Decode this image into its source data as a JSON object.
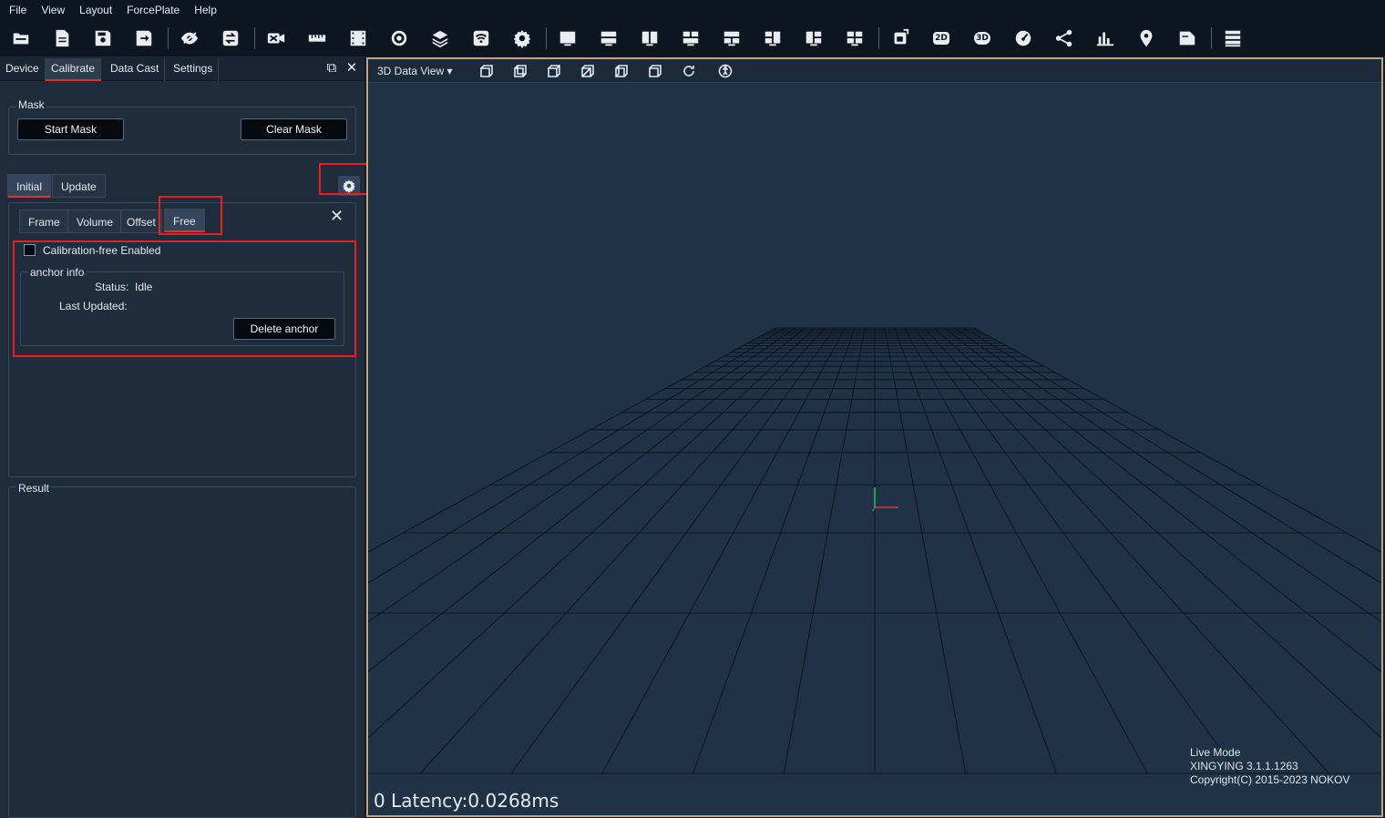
{
  "menu": [
    "File",
    "View",
    "Layout",
    "ForcePlate",
    "Help"
  ],
  "toolbar": {
    "icons": [
      "open-folder-icon",
      "new-file-icon",
      "save-icon",
      "export-icon",
      "hide-icon",
      "sync-icon",
      "camera-off-icon",
      "ruler-icon",
      "film-icon",
      "record-icon",
      "layers-icon",
      "wifi-icon",
      "settings-icon",
      "layout-single-icon",
      "layout-two-row-icon",
      "layout-two-col-icon",
      "layout-grid-icon",
      "layout-top-two-icon",
      "layout-left-two-icon",
      "layout-right-two-icon",
      "layout-four-icon",
      "rotate-view-icon",
      "view-2d-icon",
      "view-3d-icon",
      "speedometer-icon",
      "skeleton-icon",
      "bar-chart-icon",
      "location-pin-icon",
      "document-icon",
      "list-icon"
    ],
    "label_2d": "2D",
    "label_3d": "3D"
  },
  "panel": {
    "tabs": [
      "Device",
      "Calibrate",
      "Data Cast",
      "Settings"
    ],
    "active_tab": "Calibrate"
  },
  "mask": {
    "title": "Mask",
    "start_label": "Start Mask",
    "clear_label": "Clear Mask"
  },
  "calib_tabs": [
    "Initial",
    "Update"
  ],
  "sub_tabs": [
    "Frame",
    "Volume",
    "Offset",
    "Free"
  ],
  "free": {
    "checkbox_label": "Calibration-free Enabled",
    "checked": false,
    "anchor_title": "anchor info",
    "status_label": "Status:",
    "status_value": "Idle",
    "last_updated_label": "Last Updated:",
    "last_updated_value": "",
    "delete_label": "Delete anchor"
  },
  "result": {
    "title": "Result"
  },
  "view": {
    "title": "3D Data View",
    "latency": "0 Latency:0.0268ms",
    "mode": "Live Mode",
    "version": "XINGYING 3.1.1.1263",
    "copyright": "Copyright(C) 2015-2023 NOKOV"
  },
  "colors": {
    "viewport_bg": "#203346",
    "grid_line": "#0b1520",
    "highlight": "#ea2020",
    "view_border": "#c9a27a"
  }
}
